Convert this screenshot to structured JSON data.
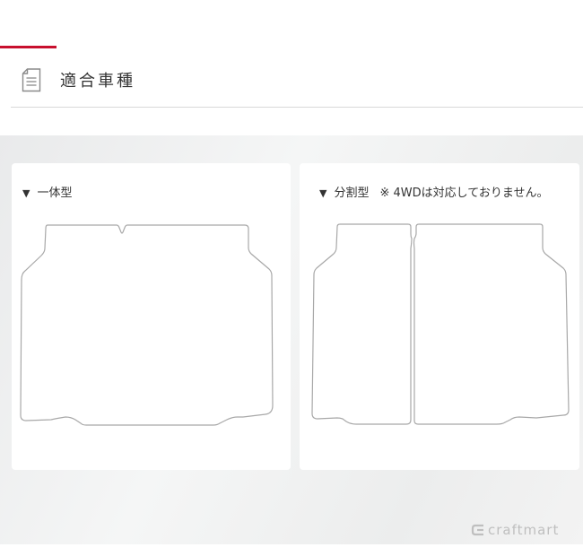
{
  "header": {
    "title": "適合車種",
    "icon": "document-icon"
  },
  "cards": {
    "one_piece": {
      "label": "一体型",
      "marker": "▼"
    },
    "split": {
      "label": "分割型",
      "marker": "▼",
      "note": "※ 4WDは対応しておりません。"
    }
  },
  "brand": {
    "logo_text": "craftmart"
  },
  "colors": {
    "accent": "#c8102e",
    "outline": "#a8a8a8"
  }
}
